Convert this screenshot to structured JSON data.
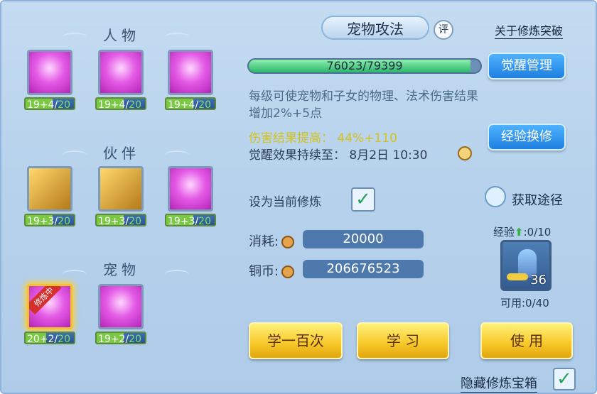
{
  "left": {
    "sections": [
      {
        "title": "人物",
        "items": [
          {
            "level": "19+4/",
            "max": "20",
            "style": "purple"
          },
          {
            "level": "19+4/",
            "max": "20",
            "style": "purple"
          },
          {
            "level": "19+4/",
            "max": "20",
            "style": "purple"
          }
        ]
      },
      {
        "title": "伙伴",
        "items": [
          {
            "level": "19+3/",
            "max": "20",
            "style": "gold"
          },
          {
            "level": "19+3/",
            "max": "20",
            "style": "gold"
          },
          {
            "level": "19+3/",
            "max": "20",
            "style": "purple"
          }
        ]
      },
      {
        "title": "宠物",
        "items": [
          {
            "level": "20+2/",
            "max": "20",
            "style": "purple",
            "badge": "修炼中"
          },
          {
            "level": "19+2/",
            "max": "20",
            "style": "purple"
          }
        ]
      }
    ]
  },
  "right": {
    "tab_title": "宠物攻法",
    "rate_label": "评",
    "about_link": "关于修炼突破",
    "progress": {
      "text": "76023/79399",
      "value": 0.9575
    },
    "awaken_button": "觉醒管理",
    "description": "每级可使宠物和子女的物理、法术伤害结果增加2%+5点",
    "damage_label": "伤害结果提高：",
    "damage_value": "44%+110",
    "duration_label": "觉醒效果持续至：",
    "duration_value": "8月2日 10:30",
    "exchange_button": "经验换修",
    "set_current_label": "设为当前修炼",
    "get_path_label": "获取途径",
    "consume_label": "消耗:",
    "consume_value": "20000",
    "copper_label": "铜币:",
    "copper_value": "206676523",
    "exp_label": "经验",
    "exp_value": ":0/10",
    "item_count": "36",
    "available_label": "可用:0/40",
    "buttons": {
      "learn100": "学一百次",
      "learn": "学 习",
      "use": "使 用"
    },
    "hide_label": "隐藏修炼宝箱",
    "colors": {
      "accent_blue": "#2b8ef0",
      "gold": "#f7c727",
      "green": "#2db56b",
      "damage_text": "#d3c21d"
    }
  }
}
